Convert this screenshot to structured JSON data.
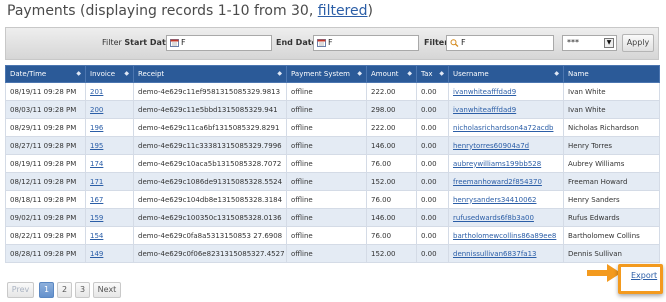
{
  "header": {
    "title_prefix": "Payments (displaying records 1-10 from 30, ",
    "title_link": "filtered",
    "title_suffix": ")"
  },
  "filters": {
    "label_filter_1": "Filter",
    "label_start": "Start Date",
    "start_value": "F",
    "label_end": "End Date",
    "end_value": "F",
    "label_filter_2": "Filter",
    "filter_value": "F",
    "select_value": "***",
    "apply_label": "Apply"
  },
  "table": {
    "columns": [
      "Date/Time",
      "Invoice",
      "Receipt",
      "Payment System",
      "Amount",
      "Tax",
      "Username",
      "Name"
    ],
    "rows": [
      {
        "date": "08/19/11 09:28 PM",
        "invoice": "201",
        "receipt": "demo-4e629c11ef9581315085329.9813",
        "system": "offline",
        "amount": "222.00",
        "tax": "0.00",
        "username": "ivanwhiteafffdad9",
        "name": "Ivan White"
      },
      {
        "date": "08/03/11 09:28 PM",
        "invoice": "200",
        "receipt": "demo-4e629c11e5bbd1315085329.941",
        "system": "offline",
        "amount": "298.00",
        "tax": "0.00",
        "username": "ivanwhiteafffdad9",
        "name": "Ivan White"
      },
      {
        "date": "08/29/11 09:28 PM",
        "invoice": "196",
        "receipt": "demo-4e629c11ca6bf1315085329.8291",
        "system": "offline",
        "amount": "222.00",
        "tax": "0.00",
        "username": "nicholasrichardson4a72acdb",
        "name": "Nicholas Richardson"
      },
      {
        "date": "08/27/11 09:28 PM",
        "invoice": "195",
        "receipt": "demo-4e629c11c33381315085329.7996",
        "system": "offline",
        "amount": "146.00",
        "tax": "0.00",
        "username": "henrytorres60904a7d",
        "name": "Henry Torres"
      },
      {
        "date": "08/19/11 09:28 PM",
        "invoice": "174",
        "receipt": "demo-4e629c10aca5b1315085328.7072",
        "system": "offline",
        "amount": "76.00",
        "tax": "0.00",
        "username": "aubreywilliams199bb528",
        "name": "Aubrey Williams"
      },
      {
        "date": "08/12/11 09:28 PM",
        "invoice": "171",
        "receipt": "demo-4e629c1086de91315085328.5524",
        "system": "offline",
        "amount": "152.00",
        "tax": "0.00",
        "username": "freemanhoward2f854370",
        "name": "Freeman Howard"
      },
      {
        "date": "08/18/11 09:28 PM",
        "invoice": "167",
        "receipt": "demo-4e629c104db8e1315085328.3184",
        "system": "offline",
        "amount": "76.00",
        "tax": "0.00",
        "username": "henrysanders34410062",
        "name": "Henry Sanders"
      },
      {
        "date": "09/02/11 09:28 PM",
        "invoice": "159",
        "receipt": "demo-4e629c100350c1315085328.0136",
        "system": "offline",
        "amount": "146.00",
        "tax": "0.00",
        "username": "rufusedwards6f8b3a00",
        "name": "Rufus Edwards"
      },
      {
        "date": "08/22/11 09:28 PM",
        "invoice": "154",
        "receipt": "demo-4e629c0fa8a5313150853 27.6908",
        "system": "offline",
        "amount": "76.00",
        "tax": "0.00",
        "username": "bartholomewcollins86a89ee8",
        "name": "Bartholomew Collins"
      },
      {
        "date": "08/28/11 09:28 PM",
        "invoice": "149",
        "receipt": "demo-4e629c0f06e8231315085327.4527",
        "system": "offline",
        "amount": "152.00",
        "tax": "0.00",
        "username": "dennissullivan6837fa13",
        "name": "Dennis Sullivan"
      }
    ]
  },
  "pagination": {
    "prev": "Prev",
    "pages": [
      "1",
      "2",
      "3"
    ],
    "current": "1",
    "next": "Next"
  },
  "export": {
    "label": "Export"
  },
  "colors": {
    "header_bg": "#2b5a98",
    "row_alt": "#e4ebf4",
    "link": "#2b5ea7",
    "highlight": "#f39a1e"
  },
  "icons": [
    "calendar-icon",
    "calendar-icon",
    "search-icon",
    "sort-icon",
    "arrow-right-icon"
  ]
}
